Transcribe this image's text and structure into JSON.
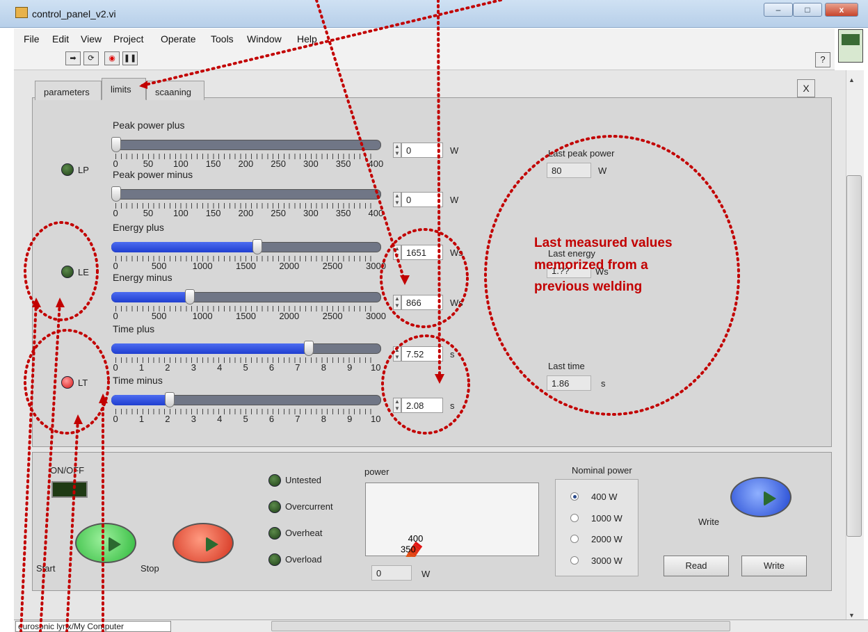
{
  "window": {
    "title": "control_panel_v2.vi",
    "btn_min": "–",
    "btn_max": "□",
    "btn_close": "x"
  },
  "menu": [
    "File",
    "Edit",
    "View",
    "Project",
    "Operate",
    "Tools",
    "Window",
    "Help"
  ],
  "toolbar": {
    "help_label": "?"
  },
  "tabs": [
    {
      "label": "parameters"
    },
    {
      "label": "limits"
    },
    {
      "label": "scaaning"
    }
  ],
  "tab_close_label": "X",
  "sliders": {
    "peak_power_plus": {
      "label": "Peak power plus",
      "value": "0",
      "unit": "W",
      "fraction": 0,
      "ticks": [
        "0",
        "50",
        "100",
        "150",
        "200",
        "250",
        "300",
        "350",
        "400"
      ]
    },
    "peak_power_minus": {
      "label": "Peak power minus",
      "value": "0",
      "unit": "W",
      "fraction": 0,
      "ticks": [
        "0",
        "50",
        "100",
        "150",
        "200",
        "250",
        "300",
        "350",
        "400"
      ]
    },
    "energy_plus": {
      "label": "Energy plus",
      "value": "1651",
      "unit": "Ws",
      "fraction": 0.5503,
      "ticks": [
        "0",
        "500",
        "1000",
        "1500",
        "2000",
        "2500",
        "3000"
      ]
    },
    "energy_minus": {
      "label": "Energy minus",
      "value": "866",
      "unit": "Ws",
      "fraction": 0.2887,
      "ticks": [
        "0",
        "500",
        "1000",
        "1500",
        "2000",
        "2500",
        "3000"
      ]
    },
    "time_plus": {
      "label": "Time plus",
      "value": "7.52",
      "unit": "s",
      "fraction": 0.752,
      "ticks": [
        "0",
        "1",
        "2",
        "3",
        "4",
        "5",
        "6",
        "7",
        "8",
        "9",
        "10"
      ]
    },
    "time_minus": {
      "label": "Time minus",
      "value": "2.08",
      "unit": "s",
      "fraction": 0.208,
      "ticks": [
        "0",
        "1",
        "2",
        "3",
        "4",
        "5",
        "6",
        "7",
        "8",
        "9",
        "10"
      ]
    }
  },
  "leds": {
    "lp": "LP",
    "le": "LE",
    "lt": "LT"
  },
  "last_values": {
    "peak_power": {
      "label": "Last peak power",
      "value": "80",
      "unit": "W"
    },
    "energy": {
      "label": "Last energy",
      "value": "1.??",
      "unit": "Ws"
    },
    "time": {
      "label": "Last time",
      "value": "1.86",
      "unit": "s"
    }
  },
  "annotation": "Last measured values memorized from a previous welding",
  "onoff_label": "ON/OFF",
  "start_label": "Start",
  "stop_label": "Stop",
  "status_leds": [
    "Untested",
    "Overcurrent",
    "Overheat",
    "Overload"
  ],
  "power": {
    "label": "power",
    "value": "0",
    "unit": "W",
    "scale": [
      "0",
      "50",
      "100",
      "150",
      "200",
      "250",
      "300",
      "350",
      "400"
    ]
  },
  "nominal_power": {
    "label": "Nominal power",
    "options": [
      "400 W",
      "1000 W",
      "2000 W",
      "3000 W"
    ],
    "selected": "400 W"
  },
  "write_label": "Write",
  "read_button": "Read",
  "write_button": "Write",
  "status_path": "eurosonic lynx/My Computer",
  "colors": {
    "accent_red": "#c20000",
    "slider_blue": "#2a48e0"
  }
}
